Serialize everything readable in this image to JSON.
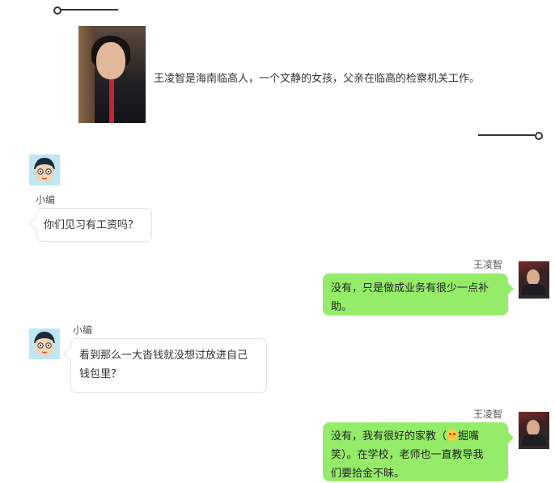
{
  "intro": {
    "photo_alt": "王凌智照片",
    "text": "王凌智是海南临高人，一个文静的女孩，父亲在临高的检察机关工作。"
  },
  "messages": [
    {
      "side": "left",
      "name": "小编",
      "lines": [
        "你们见习有工资吗？"
      ]
    },
    {
      "side": "right",
      "name": "王凌智",
      "lines": [
        "没有，只是做成业务有很少一点补",
        "助。"
      ]
    },
    {
      "side": "left",
      "name": "小编",
      "lines": [
        "看到那么一大沓钱就没想过放进自己",
        "钱包里？"
      ]
    },
    {
      "side": "right",
      "name": "王凌智",
      "line1_pre": "没有，我有很好的家教（",
      "emoji": "heart-eyes-emoji",
      "line1_post": "掘嘴",
      "lines_rest": [
        "笑）。在学校，老师也一直教导我",
        "们要拾金不昧。"
      ]
    }
  ],
  "colors": {
    "right_bubble": "#95ec69",
    "left_bubble": "#ffffff"
  }
}
